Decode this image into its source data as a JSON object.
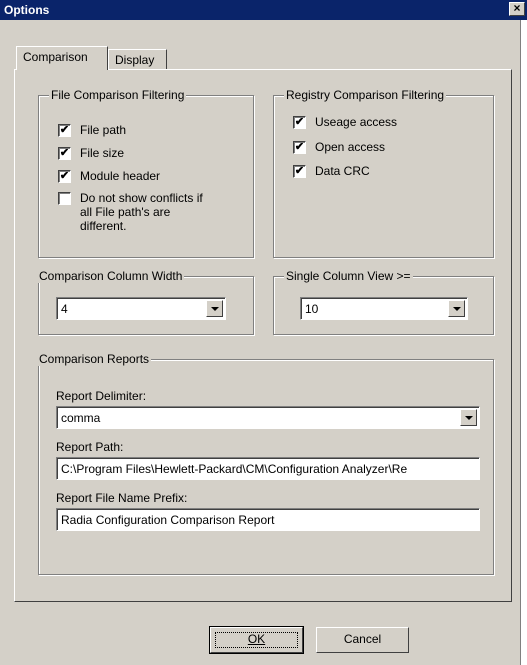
{
  "window": {
    "title": "Options",
    "close_glyph": "×"
  },
  "tabs": [
    {
      "label": "Comparison"
    },
    {
      "label": "Display"
    }
  ],
  "file_filtering": {
    "legend": "File Comparison Filtering",
    "items": [
      {
        "label": "File path",
        "checked": true
      },
      {
        "label": "File size",
        "checked": true
      },
      {
        "label": "Module header",
        "checked": true
      },
      {
        "label_lines": [
          "Do not show conflicts if",
          "all  File path's are",
          "different."
        ],
        "checked": false
      }
    ]
  },
  "registry_filtering": {
    "legend": "Registry Comparison Filtering",
    "items": [
      {
        "label": "Useage access",
        "checked": true
      },
      {
        "label": "Open access",
        "checked": true
      },
      {
        "label": "Data CRC",
        "checked": true
      }
    ]
  },
  "column_width": {
    "legend": "Comparison Column Width",
    "value": "4"
  },
  "single_column": {
    "legend": "Single Column View >=",
    "value": "10"
  },
  "reports": {
    "legend": "Comparison Reports",
    "delimiter_label": "Report Delimiter:",
    "delimiter_value": "comma",
    "path_label": "Report Path:",
    "path_value": "C:\\Program Files\\Hewlett-Packard\\CM\\Configuration Analyzer\\Re",
    "prefix_label": "Report File Name Prefix:",
    "prefix_value": "Radia Configuration Comparison Report"
  },
  "buttons": {
    "ok": "OK",
    "cancel": "Cancel"
  },
  "check_glyph": "✔"
}
